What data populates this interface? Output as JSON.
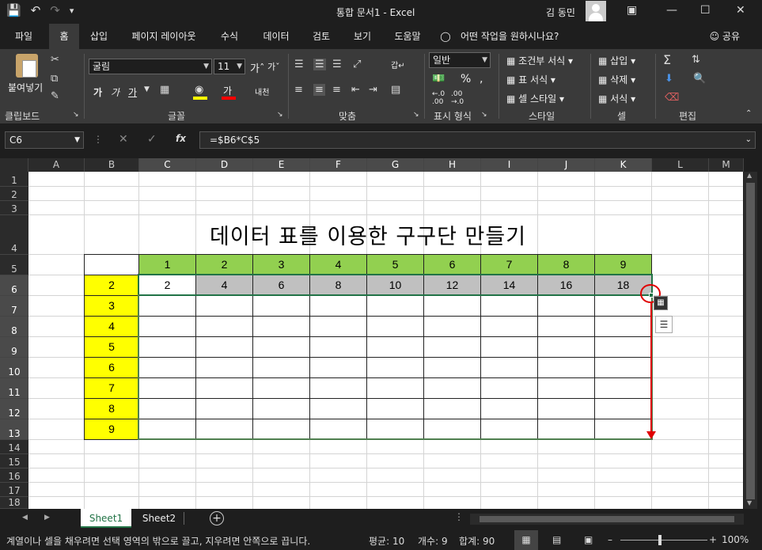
{
  "title": {
    "window": "통합 문서1 - Excel",
    "user": "김 동민"
  },
  "tabs": [
    "파일",
    "홈",
    "삽입",
    "페이지 레이아웃",
    "수식",
    "데이터",
    "검토",
    "보기",
    "도움말"
  ],
  "tell_me": "어떤 작업을 원하시나요?",
  "share": "공유",
  "ribbon": {
    "paste": "붙여넣기",
    "clipboard": "클립보드",
    "font_name": "굴림",
    "font_size": "11",
    "font": "글꼴",
    "bold": "가",
    "italic": "가",
    "underline": "가",
    "phonetic": "내천",
    "align": "맞춤",
    "number_format": "일반",
    "number": "표시 형식",
    "cond_format": "조건부 서식",
    "table_format": "표 서식",
    "cell_style": "셀 스타일",
    "styles": "스타일",
    "insert": "삽입",
    "delete": "삭제",
    "format": "서식",
    "cells": "셀",
    "editing": "편집",
    "percent": "%",
    "comma": ",",
    "inc_dec": ".0\n.00",
    "dec_dec": ".00\n.0"
  },
  "formula_bar": {
    "name_box": "C6",
    "formula": "=$B6*C$5",
    "fx": "fx"
  },
  "columns": [
    "A",
    "B",
    "C",
    "D",
    "E",
    "F",
    "G",
    "H",
    "I",
    "J",
    "K",
    "L",
    "M"
  ],
  "rows": [
    "1",
    "2",
    "3",
    "4",
    "5",
    "6",
    "7",
    "8",
    "9",
    "10",
    "11",
    "12",
    "13",
    "14",
    "15",
    "16",
    "17",
    "18"
  ],
  "sheet_title": "데이터 표를 이용한 구구단 만들기",
  "header_row": [
    "1",
    "2",
    "3",
    "4",
    "5",
    "6",
    "7",
    "8",
    "9"
  ],
  "multipliers": [
    "2",
    "3",
    "4",
    "5",
    "6",
    "7",
    "8",
    "9"
  ],
  "row6_values": [
    "2",
    "4",
    "6",
    "8",
    "10",
    "12",
    "14",
    "16",
    "18"
  ],
  "sheets": [
    "Sheet1",
    "Sheet2"
  ],
  "status": {
    "message": "계열이나 셀을 채우려면 선택 영역의 밖으로 끌고, 지우려면 안쪽으로 끕니다.",
    "average": "평균: 10",
    "count": "개수: 9",
    "sum": "합계: 90",
    "zoom": "100%"
  },
  "colors": {
    "green_header": "#92d050",
    "yellow": "#ffff00",
    "gray_fill": "#c0c0c0",
    "selection_border": "#217346",
    "arrow_red": "#e00000"
  }
}
